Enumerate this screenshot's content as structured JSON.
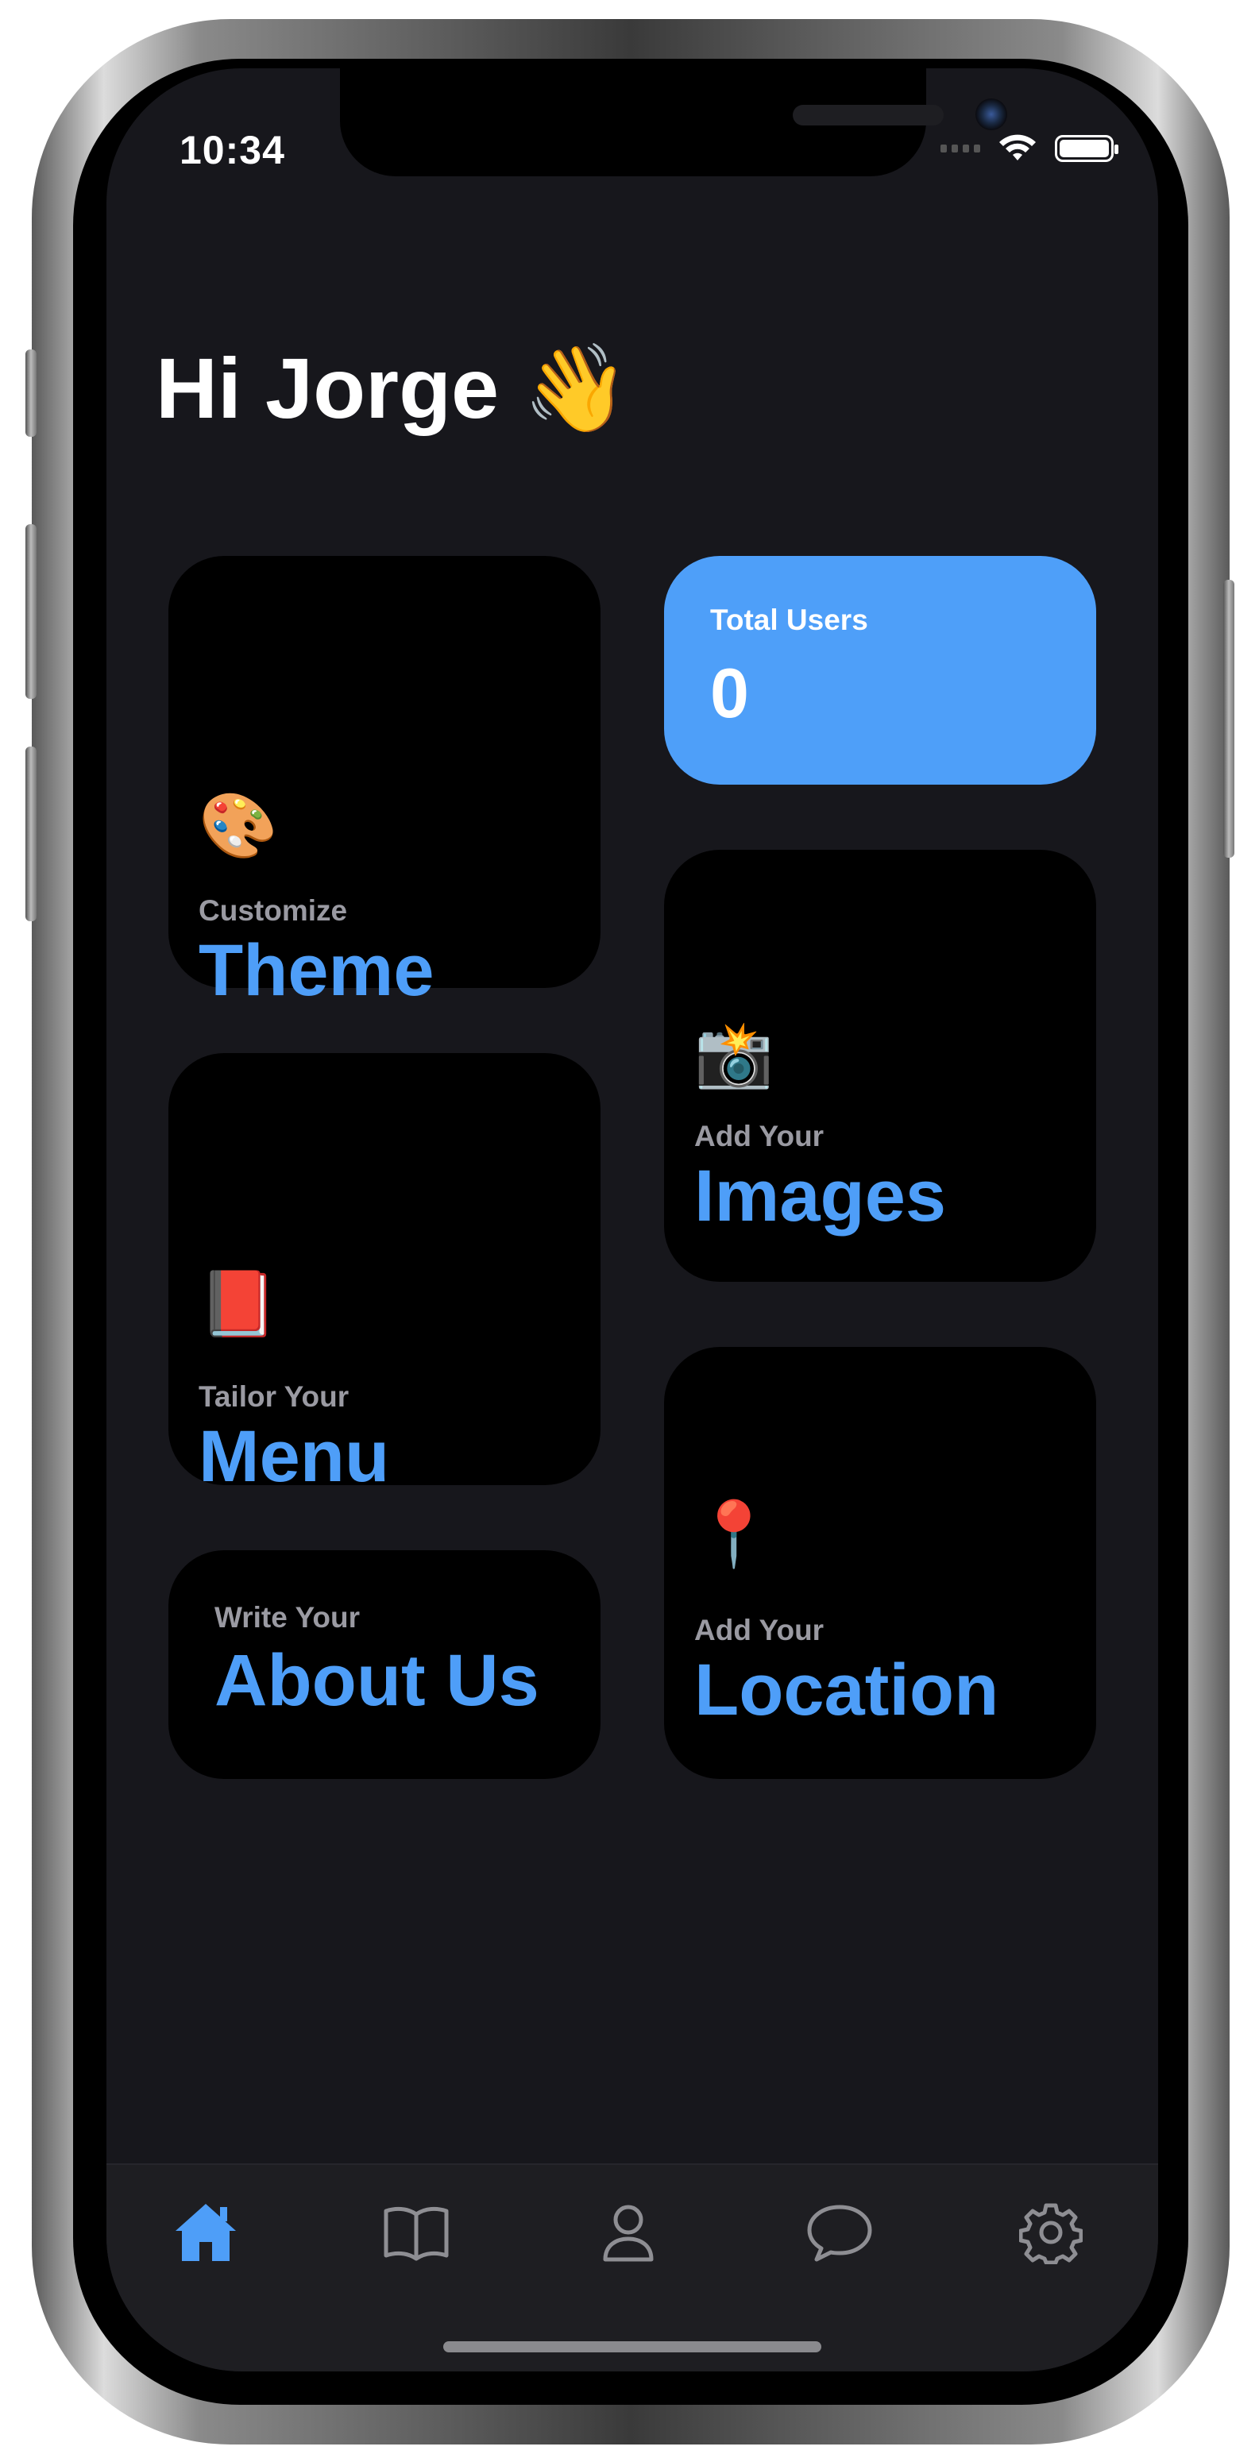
{
  "status_bar": {
    "time": "10:34"
  },
  "greeting": {
    "text": "Hi Jorge",
    "emoji": "👋"
  },
  "cards": {
    "theme": {
      "emoji": "🎨",
      "subtitle": "Customize",
      "title": "Theme"
    },
    "images": {
      "emoji": "📸",
      "subtitle": "Add Your",
      "title": "Images"
    },
    "menu": {
      "emoji": "📕",
      "subtitle": "Tailor Your",
      "title": "Menu"
    },
    "location": {
      "emoji": "📍",
      "subtitle": "Add Your",
      "title": "Location"
    },
    "about": {
      "subtitle": "Write Your",
      "title": "About Us"
    }
  },
  "stats": {
    "total_users_label": "Total Users",
    "total_users_value": "0"
  },
  "tab_bar": {
    "tabs": [
      {
        "icon": "home-icon",
        "active": true
      },
      {
        "icon": "book-icon",
        "active": false
      },
      {
        "icon": "person-icon",
        "active": false
      },
      {
        "icon": "chat-bubble-icon",
        "active": false
      },
      {
        "icon": "gear-icon",
        "active": false
      }
    ]
  },
  "colors": {
    "accent": "#4e9ef8",
    "background": "#17171c",
    "card": "#000000",
    "inactive_icon": "#8e8e93"
  }
}
